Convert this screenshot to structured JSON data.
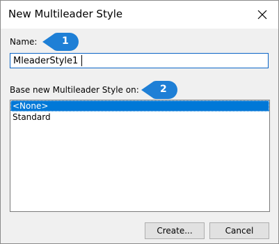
{
  "dialog": {
    "title": "New Multileader Style",
    "close_icon": "close-icon"
  },
  "name_field": {
    "label": "Name:",
    "value": "MleaderStyle1"
  },
  "base_style": {
    "label": "Base new Multileader Style on:",
    "options": [
      "<None>",
      "Standard"
    ],
    "selected": "<None>"
  },
  "buttons": {
    "create": "Create...",
    "cancel": "Cancel"
  },
  "callouts": [
    {
      "number": "1",
      "icon": "callout-marker-icon"
    },
    {
      "number": "2",
      "icon": "callout-marker-icon"
    }
  ],
  "colors": {
    "accent": "#1e7fd6",
    "selection": "#0078d7",
    "input_border": "#0a64c6"
  }
}
